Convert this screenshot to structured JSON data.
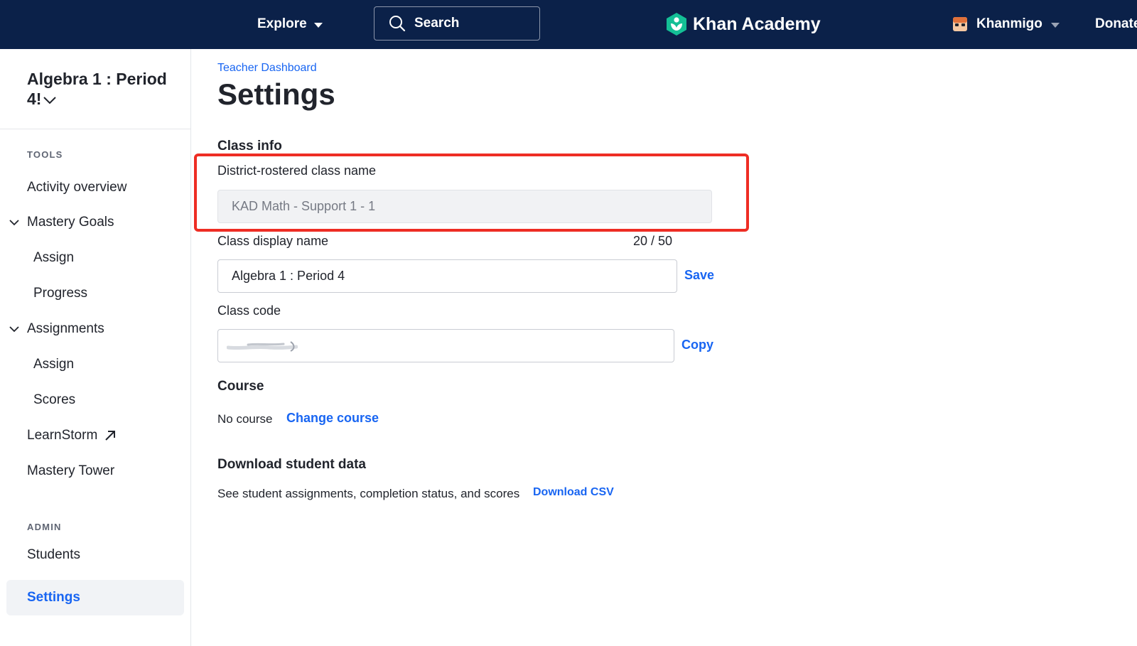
{
  "topbar": {
    "explore_label": "Explore",
    "search_label": "Search",
    "brand": "Khan Academy",
    "khanmigo_label": "Khanmigo",
    "donate_label": "Donate"
  },
  "sidebar": {
    "class_name": "Algebra 1 : Period 4!",
    "tools_heading": "TOOLS",
    "items": {
      "activity_overview": "Activity overview",
      "mastery_goals": "Mastery Goals",
      "mastery_assign": "Assign",
      "mastery_progress": "Progress",
      "assignments": "Assignments",
      "assignments_assign": "Assign",
      "assignments_scores": "Scores",
      "learnstorm": "LearnStorm",
      "mastery_tower": "Mastery Tower"
    },
    "admin_heading": "ADMIN",
    "admin_items": {
      "students": "Students",
      "settings": "Settings"
    }
  },
  "main": {
    "breadcrumb": "Teacher Dashboard",
    "title": "Settings",
    "class_info": {
      "heading": "Class info",
      "district_label": "District-rostered class name",
      "district_value": "KAD Math - Support 1 - 1",
      "display_label": "Class display name",
      "display_counter": "20 / 50",
      "display_value": "Algebra 1 : Period 4",
      "save_label": "Save",
      "code_label": "Class code",
      "copy_label": "Copy"
    },
    "course": {
      "heading": "Course",
      "value": "No course",
      "change_label": "Change course"
    },
    "download": {
      "heading": "Download student data",
      "description": "See student assignments, completion status, and scores",
      "download_label": "Download CSV"
    }
  },
  "colors": {
    "nav_bg": "#0b2149",
    "link": "#1865f2",
    "highlight": "#ee2d24",
    "logo_green": "#14bf96"
  }
}
